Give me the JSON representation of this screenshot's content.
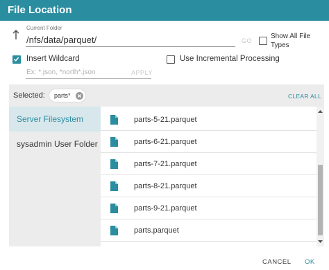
{
  "dialog": {
    "title": "File Location"
  },
  "current_folder": {
    "label": "Current Folder",
    "value": "/nfs/data/parquet/",
    "go_label": "GO"
  },
  "show_all_types": {
    "label": "Show All File Types",
    "checked": false
  },
  "insert_wildcard": {
    "label": "Insert Wildcard",
    "checked": true,
    "placeholder": "Ex: *.json, *north*.json",
    "value": "",
    "apply_label": "APPLY"
  },
  "incremental": {
    "label": "Use Incremental Processing",
    "checked": false
  },
  "selected": {
    "label": "Selected:",
    "chips": [
      "parts*"
    ],
    "clear_all_label": "CLEAR ALL"
  },
  "sources": [
    {
      "label": "Server Filesystem",
      "active": true
    },
    {
      "label": "sysadmin User Folder",
      "active": false
    }
  ],
  "files": [
    "parts-5-21.parquet",
    "parts-6-21.parquet",
    "parts-7-21.parquet",
    "parts-8-21.parquet",
    "parts-9-21.parquet",
    "parts.parquet"
  ],
  "footer": {
    "cancel_label": "CANCEL",
    "ok_label": "OK"
  },
  "colors": {
    "accent": "#2b8da0",
    "panel": "#ececec",
    "active_source": "#d7e7ec"
  }
}
